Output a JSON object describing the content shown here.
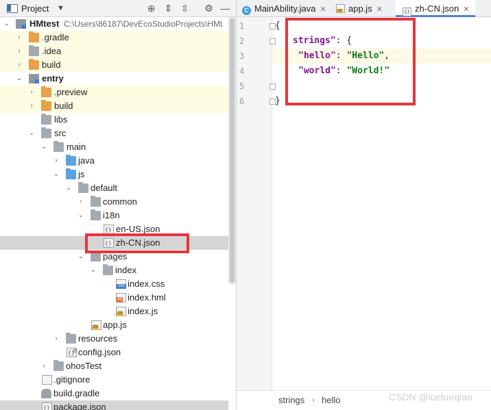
{
  "project_panel": {
    "title": "Project",
    "toolbar_icons": [
      "locate-icon",
      "expand-all-icon",
      "collapse-all-icon",
      "gear-icon",
      "hide-icon"
    ],
    "tree": [
      {
        "label": "HMtest",
        "suffix": "C:\\Users\\86187\\DevEcoStudioProjects\\HMt",
        "icon": "module",
        "bold": true
      },
      {
        "label": ".gradle",
        "icon": "folder-orange"
      },
      {
        "label": ".idea",
        "icon": "folder-grey"
      },
      {
        "label": "build",
        "icon": "folder-orange"
      },
      {
        "label": "entry",
        "icon": "module",
        "bold": true
      },
      {
        "label": ".preview",
        "icon": "folder-orange"
      },
      {
        "label": "build",
        "icon": "folder-orange"
      },
      {
        "label": "libs",
        "icon": "folder-grey"
      },
      {
        "label": "src",
        "icon": "folder-grey"
      },
      {
        "label": "main",
        "icon": "folder-grey"
      },
      {
        "label": "java",
        "icon": "folder-blue"
      },
      {
        "label": "js",
        "icon": "folder-blue"
      },
      {
        "label": "default",
        "icon": "folder-grey"
      },
      {
        "label": "common",
        "icon": "folder-grey"
      },
      {
        "label": "i18n",
        "icon": "folder-grey"
      },
      {
        "label": "en-US.json",
        "icon": "json-file"
      },
      {
        "label": "zh-CN.json",
        "icon": "json-file"
      },
      {
        "label": "pages",
        "icon": "folder-grey"
      },
      {
        "label": "index",
        "icon": "folder-grey"
      },
      {
        "label": "index.css",
        "icon": "css-file"
      },
      {
        "label": "index.hml",
        "icon": "hml-file"
      },
      {
        "label": "index.js",
        "icon": "js-file"
      },
      {
        "label": "app.js",
        "icon": "js-file"
      },
      {
        "label": "resources",
        "icon": "resources-folder"
      },
      {
        "label": "config.json",
        "icon": "config-file"
      },
      {
        "label": "ohosTest",
        "icon": "folder-grey"
      },
      {
        "label": ".gitignore",
        "icon": "gitignore-file"
      },
      {
        "label": "build.gradle",
        "icon": "gradle-file"
      },
      {
        "label": "package.json",
        "icon": "json-file"
      }
    ]
  },
  "editor": {
    "tabs": [
      {
        "label": "MainAbility.java",
        "icon": "class-icon",
        "active": false
      },
      {
        "label": "app.js",
        "icon": "js-file-icon",
        "active": false
      },
      {
        "label": "zh-CN.json",
        "icon": "json-file-icon",
        "active": true
      }
    ],
    "line_numbers": [
      "1",
      "2",
      "3",
      "4",
      "5",
      "6"
    ],
    "code": {
      "line1": "{",
      "line2_key": "strings\"",
      "line2_rest": ": {",
      "line3_key": "\"hello\"",
      "line3_colon": ": ",
      "line3_val": "\"Hello\"",
      "line3_end": ",",
      "line4_key": "\"world\"",
      "line4_colon": ": ",
      "line4_val": "\"World!\"",
      "line6": "}"
    },
    "breadcrumb": [
      "strings",
      "hello"
    ]
  },
  "watermark": "CSDN @luelueqiao",
  "colors": {
    "annotation": "#e8343b",
    "json_key": "#871094",
    "json_string": "#067d17",
    "selection": "#d5d5d5",
    "active_tab_accent": "#4c83d6"
  }
}
